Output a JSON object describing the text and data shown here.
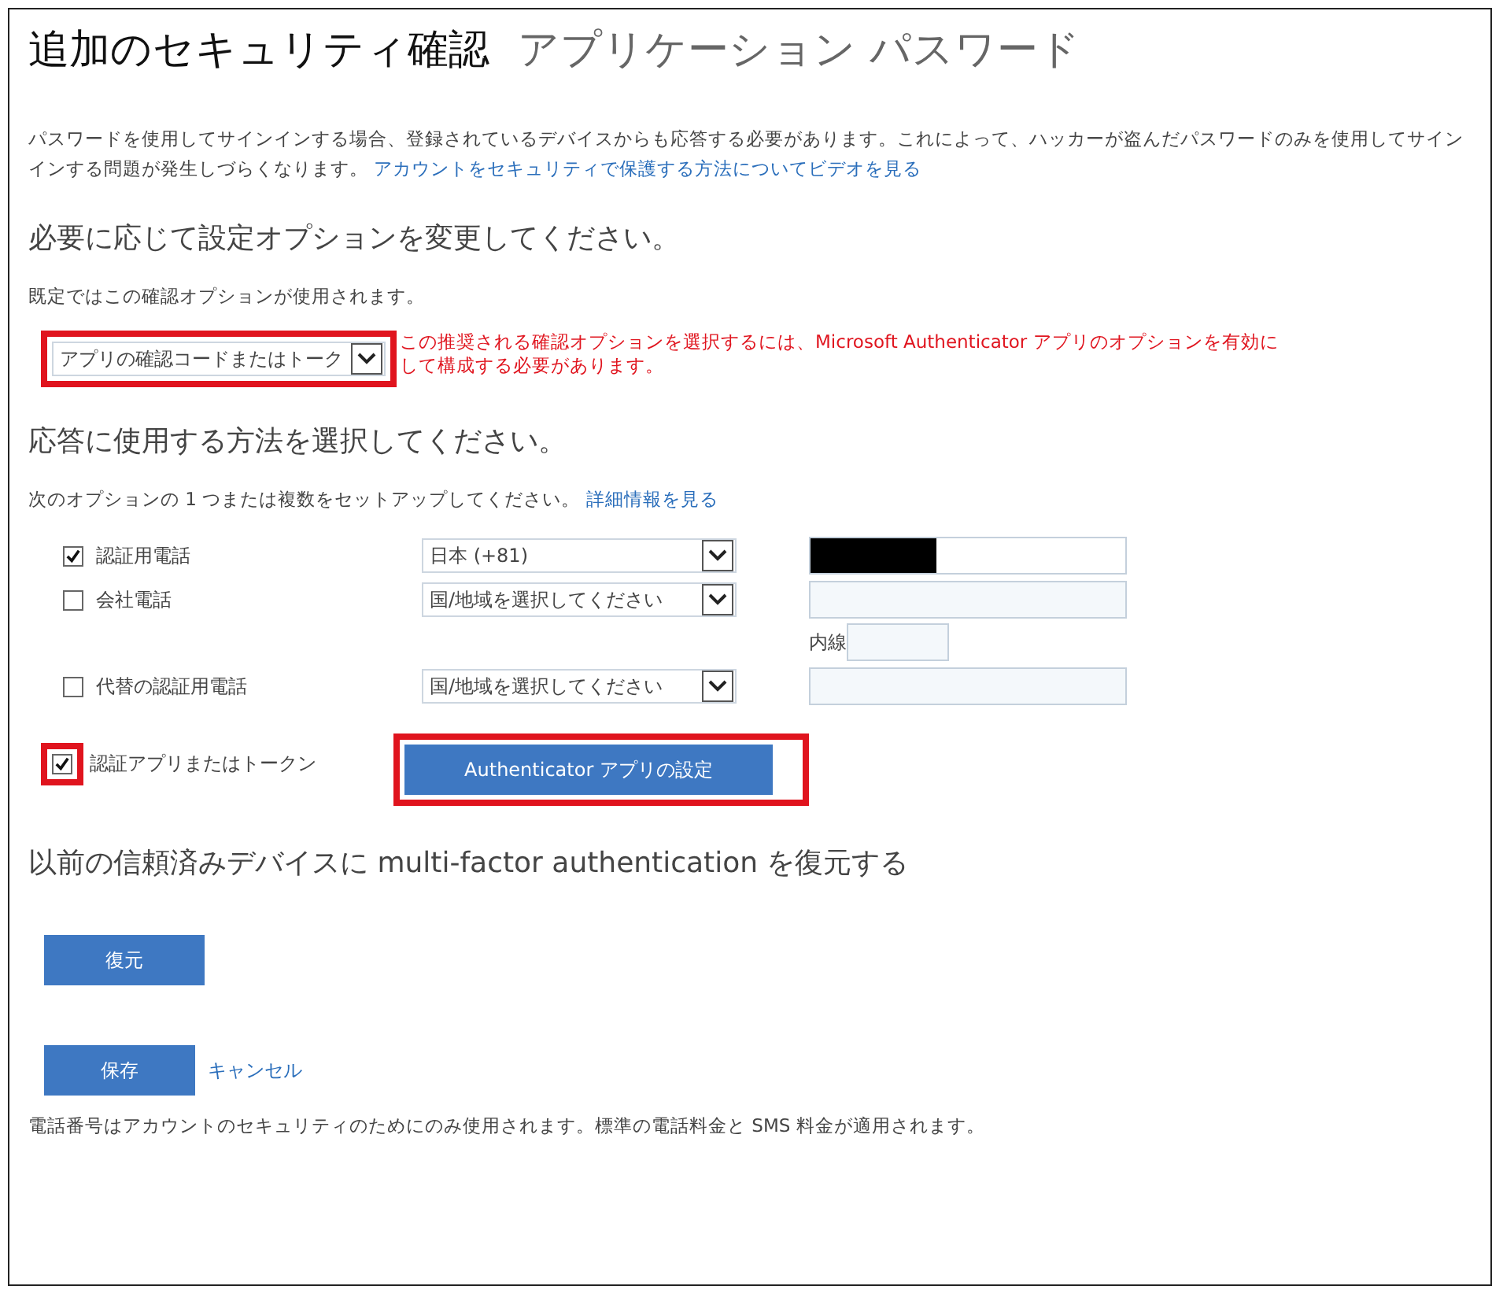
{
  "tabs": [
    {
      "label": "追加のセキュリティ確認",
      "selected": true
    },
    {
      "label": "アプリケーション パスワード",
      "selected": false
    }
  ],
  "intro": {
    "text": "パスワードを使用してサインインする場合、登録されているデバイスからも応答する必要があります。これによって、ハッカーが盗んだパスワードのみを使用してサインインする問題が発生しづらくなります。",
    "link": "アカウントをセキュリティで保護する方法についてビデオを見る"
  },
  "option_section": {
    "heading": "必要に応じて設定オプションを変更してください。",
    "note": "既定ではこの確認オプションが使用されます。",
    "select_value": "アプリの確認コードまたはトーク",
    "highlighted": true,
    "warning": "この推奨される確認オプションを選択するには、Microsoft Authenticator アプリのオプションを有効にして構成する必要があります。"
  },
  "method_section": {
    "heading": "応答に使用する方法を選択してください。",
    "note": "次のオプションの 1 つまたは複数をセットアップしてください。",
    "link": "詳細情報を見る"
  },
  "methods": [
    {
      "kind": "phone",
      "label": "認証用電話",
      "checked": true,
      "country": "日本 (+81)",
      "redacted": true
    },
    {
      "kind": "phone",
      "label": "会社電話",
      "checked": false,
      "country": "国/地域を選択してください",
      "extension_label": "内線"
    },
    {
      "kind": "phone",
      "label": "代替の認証用電話",
      "checked": false,
      "country": "国/地域を選択してください"
    },
    {
      "kind": "app",
      "label": "認証アプリまたはトークン",
      "checked": true,
      "highlighted": true,
      "button": "Authenticator アプリの設定"
    }
  ],
  "restore": {
    "heading": "以前の信頼済みデバイスに multi-factor authentication を復元する",
    "button": "復元"
  },
  "actions": {
    "save": "保存",
    "cancel": "キャンセル"
  },
  "footer": "電話番号はアカウントのセキュリティのためにのみ使用されます。標準の電話料金と SMS 料金が適用されます。"
}
